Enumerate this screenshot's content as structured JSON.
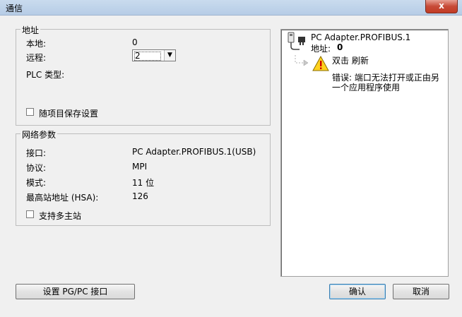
{
  "window": {
    "title": "通信",
    "close_glyph": "x"
  },
  "address_group": {
    "title": "地址",
    "local_label": "本地:",
    "local_value": "0",
    "remote_label": "远程:",
    "remote_value": "2",
    "plc_type_label": "PLC 类型:",
    "save_with_project_label": "随项目保存设置",
    "save_with_project_checked": false
  },
  "network_group": {
    "title": "网络参数",
    "interface_label": "接口:",
    "interface_value": "PC Adapter.PROFIBUS.1(USB)",
    "protocol_label": "协议:",
    "protocol_value": "MPI",
    "mode_label": "模式:",
    "mode_value": "11 位",
    "hsa_label": "最高站地址 (HSA):",
    "hsa_value": "126",
    "multi_master_label": "支持多主站",
    "multi_master_checked": false
  },
  "network_tree": {
    "adapter_name": "PC Adapter.PROFIBUS.1",
    "address_label": "地址:",
    "address_value": "0",
    "refresh_label": "双击 刷新",
    "error_line1": "错误: 端口无法打开或正由另",
    "error_line2": "一个应用程序使用"
  },
  "buttons": {
    "set_pgpc": "设置 PG/PC 接口",
    "ok": "确认",
    "cancel": "取消"
  }
}
